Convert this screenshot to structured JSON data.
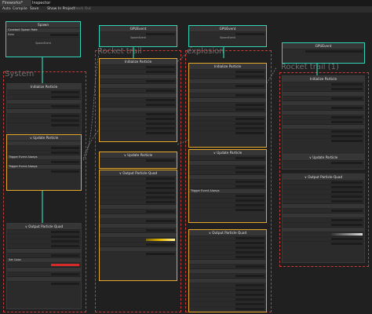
{
  "tabs": [
    "Fireworks*",
    "Inspector"
  ],
  "toolbar": {
    "auto": "Auto",
    "compile": "Compile",
    "save": "Save",
    "show_in_project": "Show In Project",
    "check_out": "Check Out"
  },
  "groups": {
    "system": "System",
    "rocket_trail": "Rocket trail",
    "explosion": "explosion",
    "rocket_trail_1": "Rocket trail (1)"
  },
  "nodes": {
    "spawn": {
      "title": "Spawn",
      "item": "Constant Spawn Rate",
      "rate": "Rate",
      "event_out": "SpawnEvent"
    },
    "gpu_event_a": {
      "title": "GPUEvent",
      "out": "SpawnEvent"
    },
    "gpu_event_b": {
      "title": "GPUEvent",
      "out": "SpawnEvent"
    },
    "gpu_event_c": {
      "title": "GPUEvent"
    },
    "initialize": "Initialize Particle",
    "update": "Update Particle",
    "output_quad": "Output Particle Quad",
    "trigger": "Trigger Event Always",
    "set_color": "Set Color"
  },
  "colors": {
    "accent": "#e6a72b",
    "link": "#2fd5b5",
    "group": "#d23b3b",
    "gradient": "#e6b800"
  }
}
